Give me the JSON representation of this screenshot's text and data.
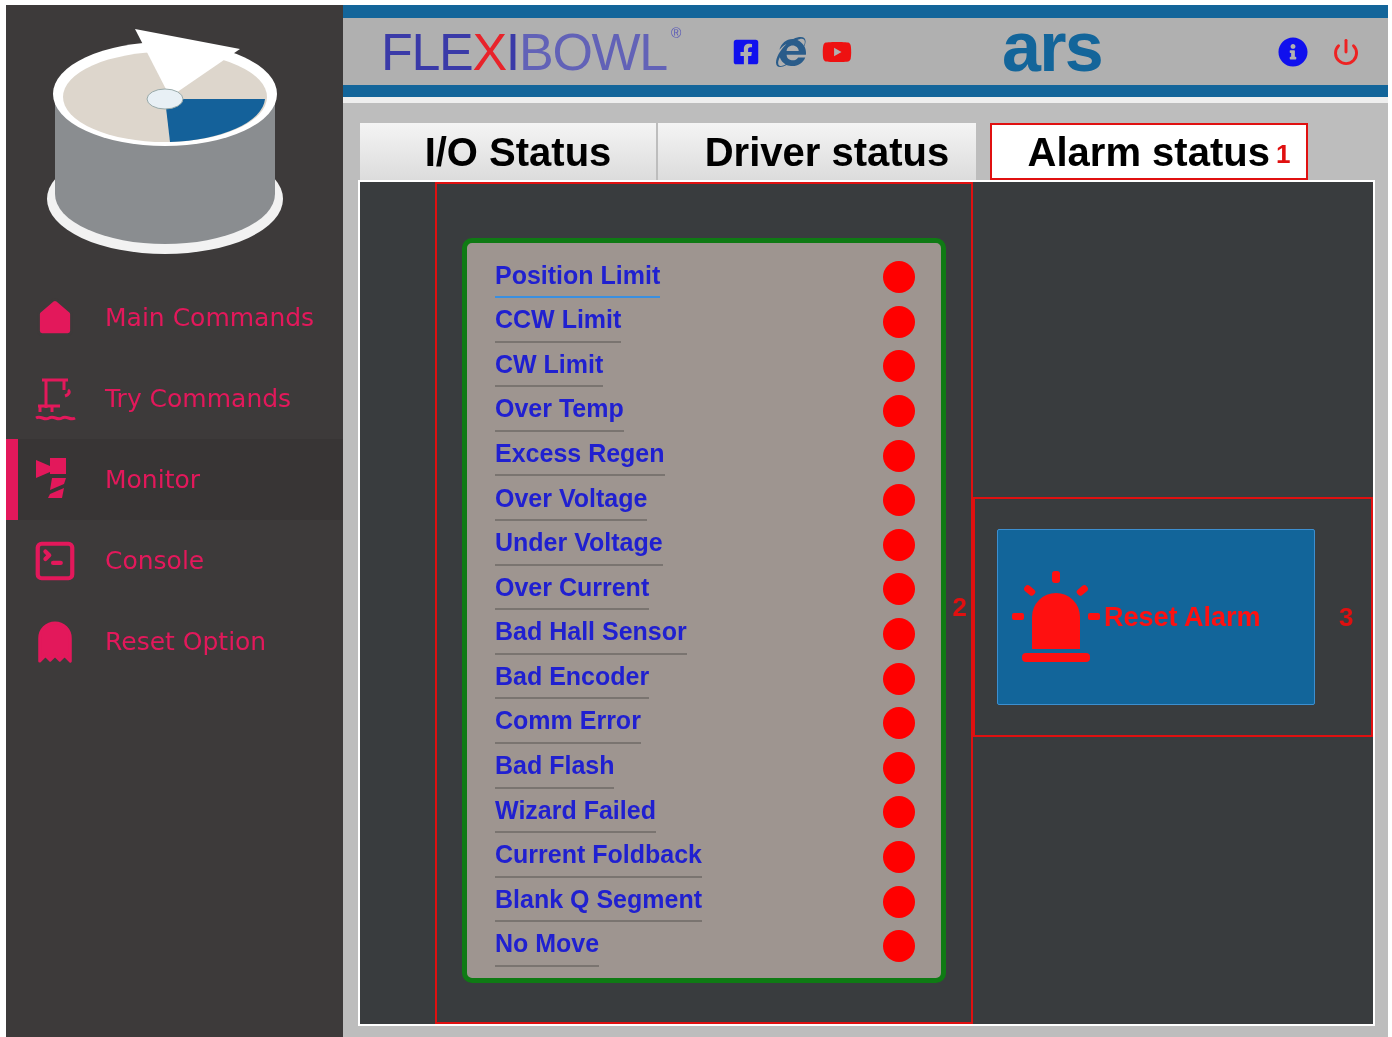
{
  "header": {
    "logo_parts": [
      {
        "text": "FLE",
        "kind": "solid"
      },
      {
        "text": "X",
        "kind": "accent"
      },
      {
        "text": "I",
        "kind": "solid"
      },
      {
        "text": "BOWL",
        "kind": "light"
      },
      {
        "text": "®",
        "kind": "mark"
      }
    ],
    "brand": "ars"
  },
  "sidebar": {
    "items": [
      {
        "label": "Main Commands",
        "selected": false
      },
      {
        "label": "Try Commands",
        "selected": false
      },
      {
        "label": "Monitor",
        "selected": true
      },
      {
        "label": "Console",
        "selected": false
      },
      {
        "label": "Reset Option",
        "selected": false
      }
    ]
  },
  "tabs": [
    {
      "label": "I/O Status",
      "selected": false
    },
    {
      "label": "Driver status",
      "selected": false
    },
    {
      "label": "Alarm status",
      "selected": true,
      "annotation": "1"
    }
  ],
  "alarms": {
    "annotation": "2",
    "items": [
      {
        "label": "Position Limit",
        "selected": true,
        "on": true
      },
      {
        "label": "CCW Limit",
        "selected": false,
        "on": true
      },
      {
        "label": "CW Limit",
        "selected": false,
        "on": true
      },
      {
        "label": "Over Temp",
        "selected": false,
        "on": true
      },
      {
        "label": "Excess Regen",
        "selected": false,
        "on": true
      },
      {
        "label": "Over Voltage",
        "selected": false,
        "on": true
      },
      {
        "label": "Under Voltage",
        "selected": false,
        "on": true
      },
      {
        "label": "Over Current",
        "selected": false,
        "on": true
      },
      {
        "label": "Bad Hall Sensor",
        "selected": false,
        "on": true
      },
      {
        "label": "Bad Encoder",
        "selected": false,
        "on": true
      },
      {
        "label": "Comm Error",
        "selected": false,
        "on": true
      },
      {
        "label": "Bad Flash",
        "selected": false,
        "on": true
      },
      {
        "label": "Wizard Failed",
        "selected": false,
        "on": true
      },
      {
        "label": "Current Foldback",
        "selected": false,
        "on": true
      },
      {
        "label": "Blank Q Segment",
        "selected": false,
        "on": true
      },
      {
        "label": "No Move",
        "selected": false,
        "on": true
      }
    ]
  },
  "reset": {
    "label": "Reset Alarm",
    "annotation": "3"
  }
}
